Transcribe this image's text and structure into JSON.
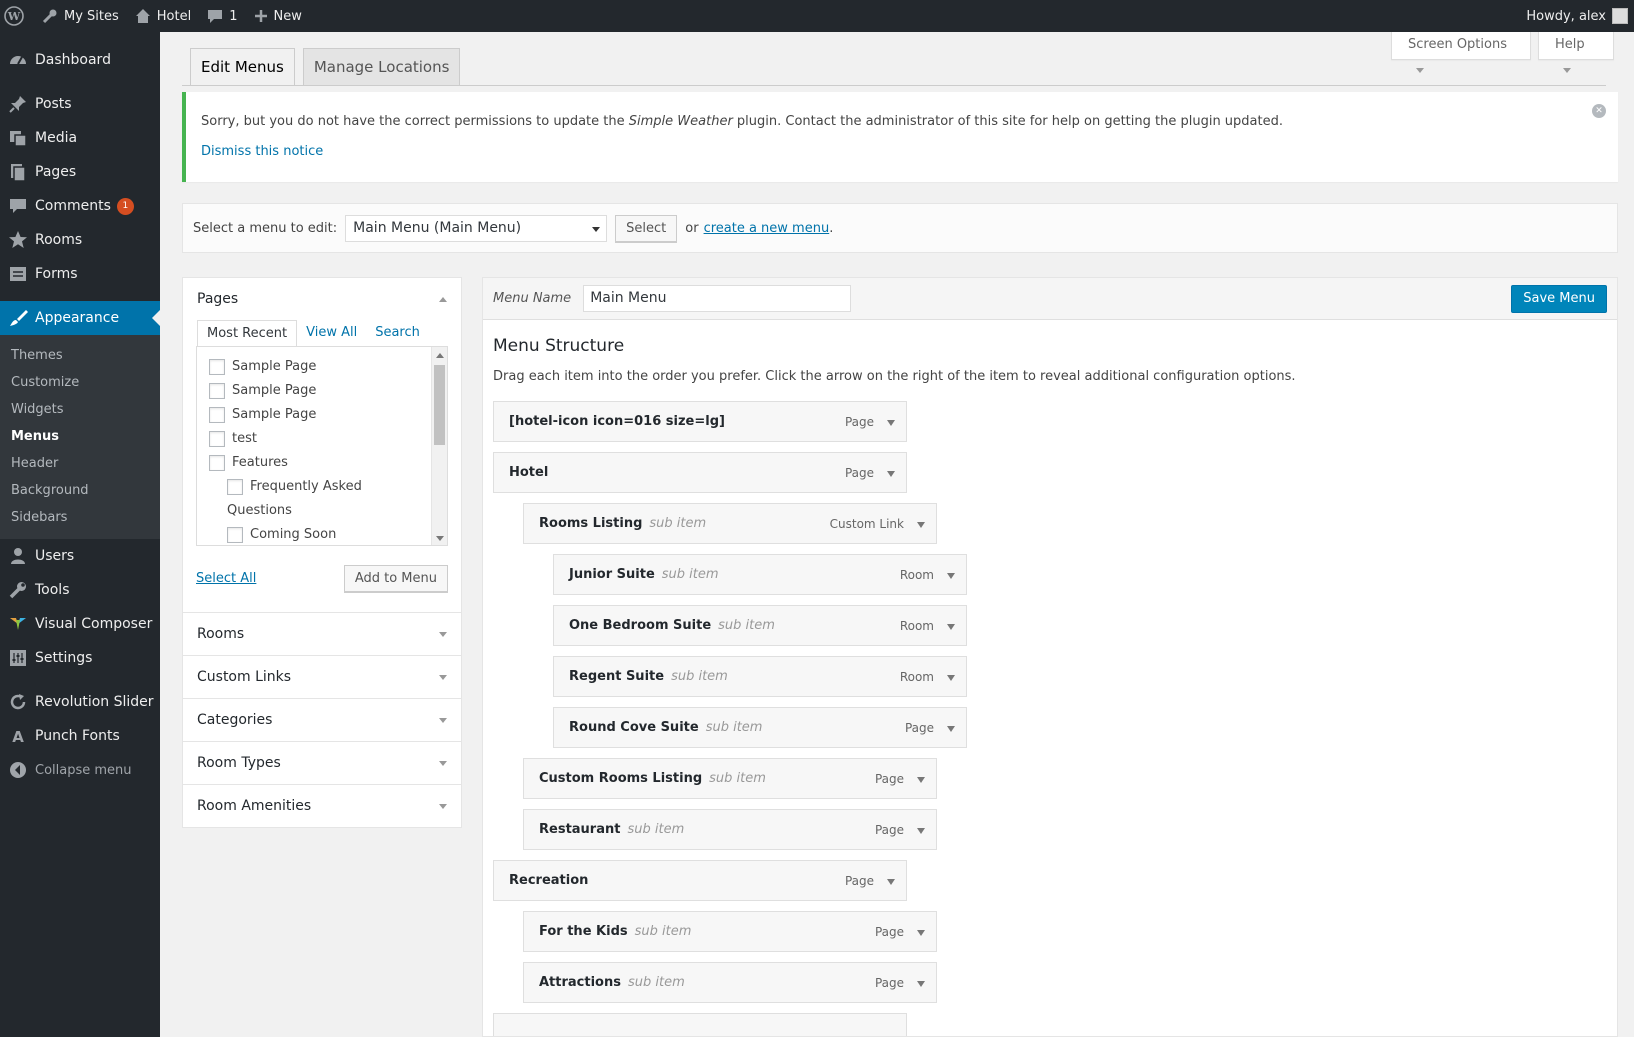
{
  "adminbar": {
    "my_sites": "My Sites",
    "site": "Hotel",
    "comments": "1",
    "new": "New",
    "howdy": "Howdy, alex"
  },
  "sidebar": {
    "items": [
      {
        "label": "Dashboard",
        "icon": "dashboard-icon"
      },
      {
        "label": "Posts",
        "icon": "pin-icon"
      },
      {
        "label": "Media",
        "icon": "media-icon"
      },
      {
        "label": "Pages",
        "icon": "pages-icon"
      },
      {
        "label": "Comments",
        "icon": "comment-icon",
        "badge": "1"
      },
      {
        "label": "Rooms",
        "icon": "star-icon"
      },
      {
        "label": "Forms",
        "icon": "forms-icon"
      },
      {
        "label": "Appearance",
        "icon": "paintbrush-icon"
      },
      {
        "label": "Users",
        "icon": "user-icon"
      },
      {
        "label": "Tools",
        "icon": "wrench-icon"
      },
      {
        "label": "Visual Composer",
        "icon": "vc-icon"
      },
      {
        "label": "Settings",
        "icon": "settings-icon"
      },
      {
        "label": "Revolution Slider",
        "icon": "refresh-icon"
      },
      {
        "label": "Punch Fonts",
        "icon": "font-icon"
      }
    ],
    "appearance_submenu": [
      "Themes",
      "Customize",
      "Widgets",
      "Menus",
      "Header",
      "Background",
      "Sidebars"
    ],
    "collapse": "Collapse menu"
  },
  "tabs": {
    "edit": "Edit Menus",
    "manage": "Manage Locations"
  },
  "screen_options": "Screen Options",
  "help": "Help",
  "notice": {
    "text_before": "Sorry, but you do not have the correct permissions to update the ",
    "plugin": "Simple Weather",
    "text_after": " plugin. Contact the administrator of this site for help on getting the plugin updated.",
    "dismiss": "Dismiss this notice"
  },
  "select_bar": {
    "label": "Select a menu to edit:",
    "selected": "Main Menu (Main Menu)",
    "button": "Select",
    "or": "or",
    "create": "create a new menu",
    "period": "."
  },
  "left": {
    "pages_title": "Pages",
    "tabs": [
      "Most Recent",
      "View All",
      "Search"
    ],
    "pages": [
      "Sample Page",
      "Sample Page",
      "Sample Page",
      "test",
      "Features",
      "Frequently Asked",
      "Questions",
      "Coming Soon"
    ],
    "select_all": "Select All",
    "add_to_menu": "Add to Menu",
    "sections": [
      "Rooms",
      "Custom Links",
      "Categories",
      "Room Types",
      "Room Amenities"
    ]
  },
  "menu": {
    "name_label": "Menu Name",
    "name_value": "Main Menu",
    "save": "Save Menu",
    "structure_title": "Menu Structure",
    "structure_desc": "Drag each item into the order you prefer. Click the arrow on the right of the item to reveal additional configuration options.",
    "sub_label": "sub item",
    "items": [
      {
        "title": "[hotel-icon icon=016 size=lg]",
        "type": "Page",
        "depth": 0
      },
      {
        "title": "Hotel",
        "type": "Page",
        "depth": 0
      },
      {
        "title": "Rooms Listing",
        "type": "Custom Link",
        "depth": 1
      },
      {
        "title": "Junior Suite",
        "type": "Room",
        "depth": 2
      },
      {
        "title": "One Bedroom Suite",
        "type": "Room",
        "depth": 2
      },
      {
        "title": "Regent Suite",
        "type": "Room",
        "depth": 2
      },
      {
        "title": "Round Cove Suite",
        "type": "Page",
        "depth": 2
      },
      {
        "title": "Custom Rooms Listing",
        "type": "Page",
        "depth": 1
      },
      {
        "title": "Restaurant",
        "type": "Page",
        "depth": 1
      },
      {
        "title": "Recreation",
        "type": "Page",
        "depth": 0
      },
      {
        "title": "For the Kids",
        "type": "Page",
        "depth": 1
      },
      {
        "title": "Attractions",
        "type": "Page",
        "depth": 1
      },
      {
        "title": "",
        "type": "",
        "depth": 0
      }
    ]
  },
  "colors": {
    "accent": "#0073aa",
    "sidebar": "#23282d",
    "notice_border": "#46b450",
    "badge": "#d54e21"
  }
}
